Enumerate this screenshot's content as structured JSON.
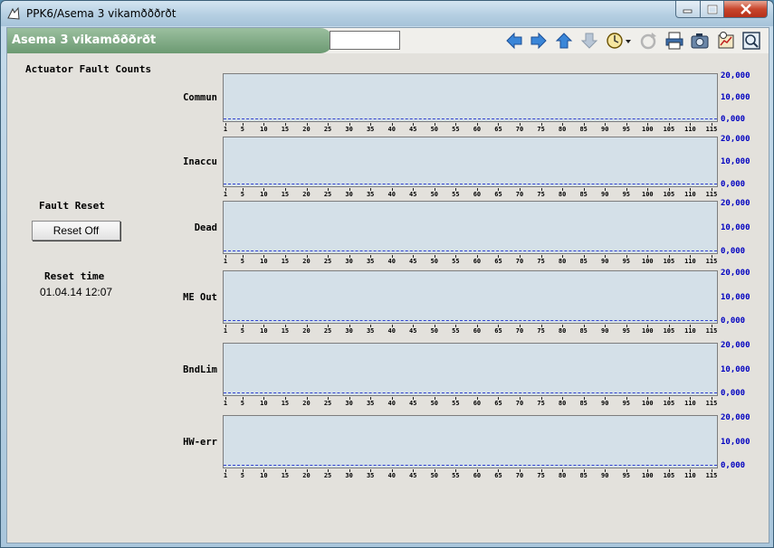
{
  "window": {
    "title": "PPK6/Asema 3 vikamðððrðt"
  },
  "toolbar": {
    "screen_title": "Asema 3 vikamðððrðt",
    "search_value": "",
    "icons": [
      "arrow-left-icon",
      "arrow-right-icon",
      "arrow-up-icon",
      "arrow-down-icon",
      "clock-dropdown-icon",
      "refresh-icon",
      "printer-icon",
      "camera-icon",
      "trend-icon",
      "zoom-icon"
    ]
  },
  "left": {
    "heading": "Actuator Fault Counts",
    "fault_reset_label": "Fault Reset",
    "reset_button": "Reset Off",
    "reset_time_label": "Reset time",
    "reset_time_value": "01.04.14 12:07"
  },
  "charts": [
    {
      "label": "Commun"
    },
    {
      "label": "Inaccu"
    },
    {
      "label": "Dead"
    },
    {
      "label": "ME Out"
    },
    {
      "label": "BndLim"
    },
    {
      "label": "HW-err"
    }
  ],
  "chart_data": {
    "type": "line",
    "x_ticks": [
      "1",
      "5",
      "10",
      "15",
      "20",
      "25",
      "30",
      "35",
      "40",
      "45",
      "50",
      "55",
      "60",
      "65",
      "70",
      "75",
      "80",
      "85",
      "90",
      "95",
      "100",
      "105",
      "110",
      "115"
    ],
    "y_ticks": [
      "20,000",
      "10,000",
      "0,000"
    ],
    "ylim": [
      0,
      20
    ],
    "xlim": [
      1,
      115
    ],
    "series_labels": [
      "Commun",
      "Inaccu",
      "Dead",
      "ME Out",
      "BndLim",
      "HW-err"
    ]
  }
}
